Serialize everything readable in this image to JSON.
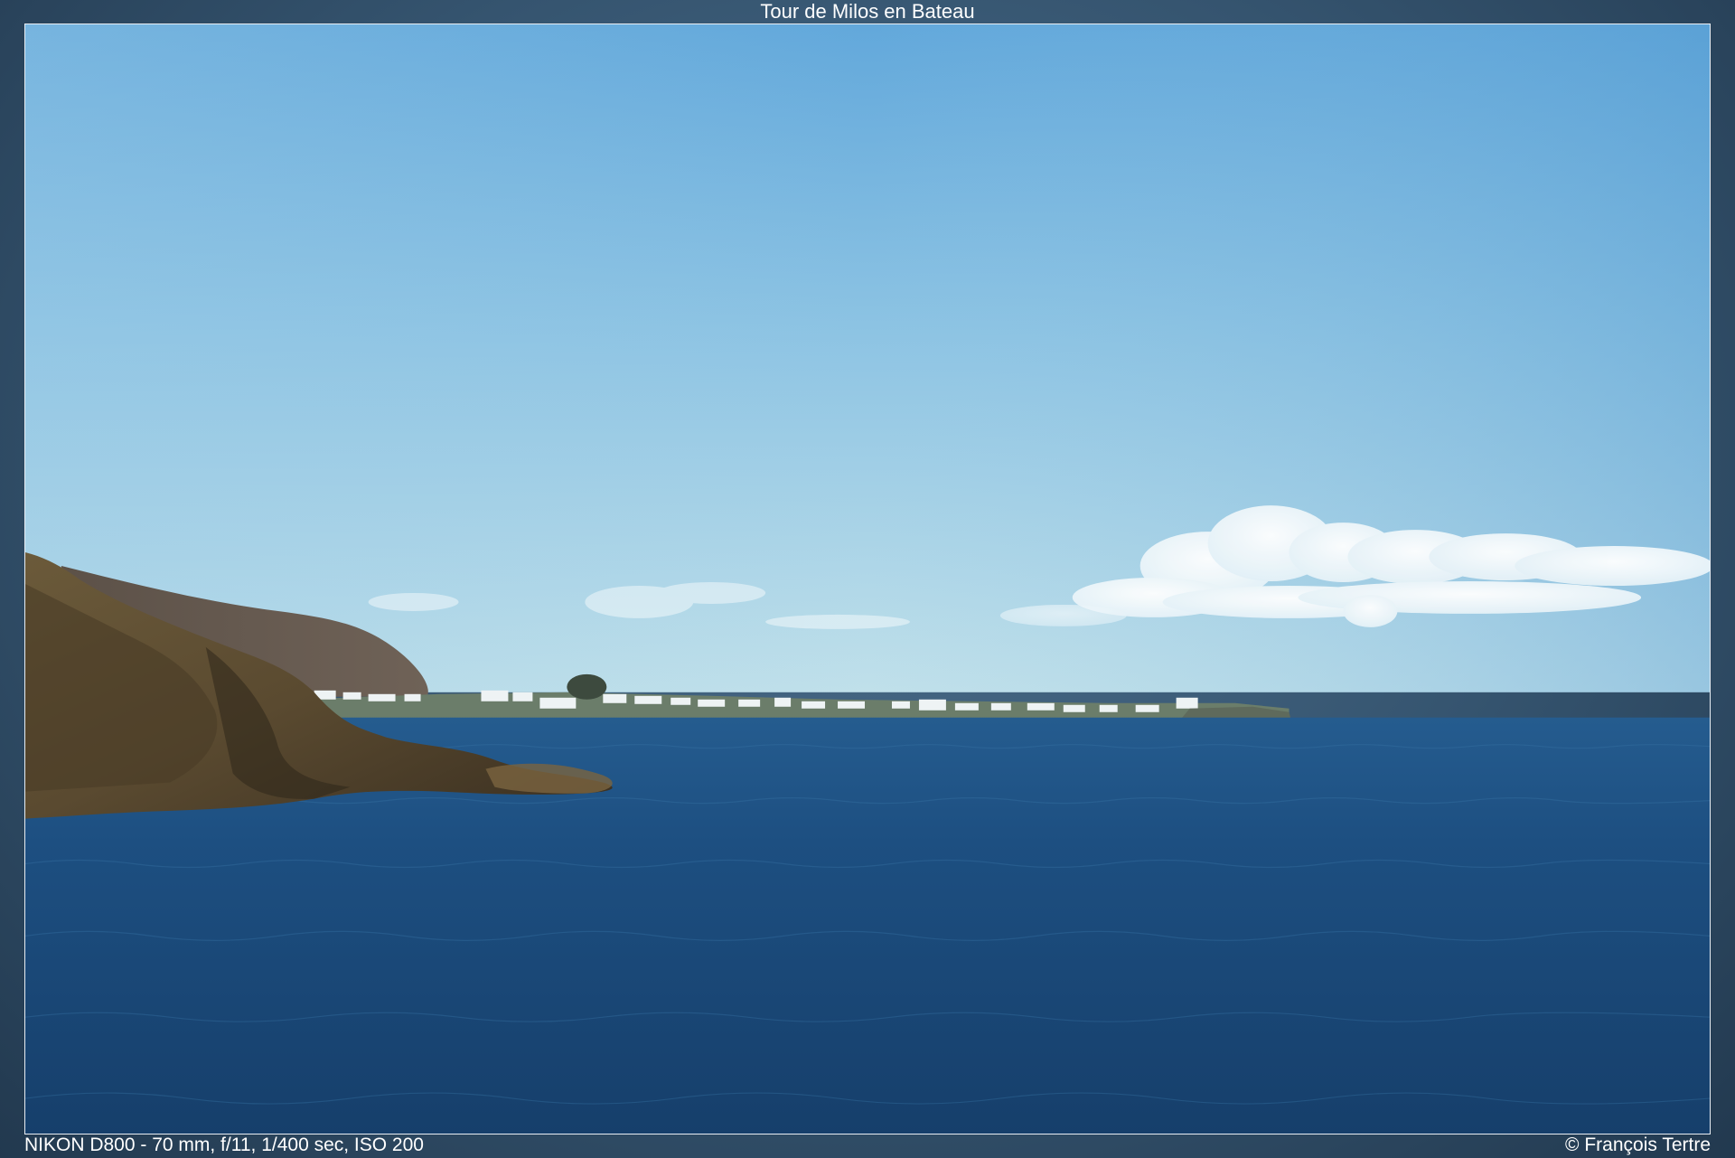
{
  "title": "Tour de Milos en Bateau",
  "caption": {
    "exif": "NIKON D800 - 70 mm, f/11, 1/400 sec, ISO 200",
    "copyright": "© François Tertre"
  },
  "colors": {
    "sky_top": "#5ea6d8",
    "sky_horizon": "#b5dbe9",
    "sea_near": "#1a4a79",
    "sea_far": "#225a8e",
    "frame": "#2d4a63",
    "text": "#ffffff"
  }
}
